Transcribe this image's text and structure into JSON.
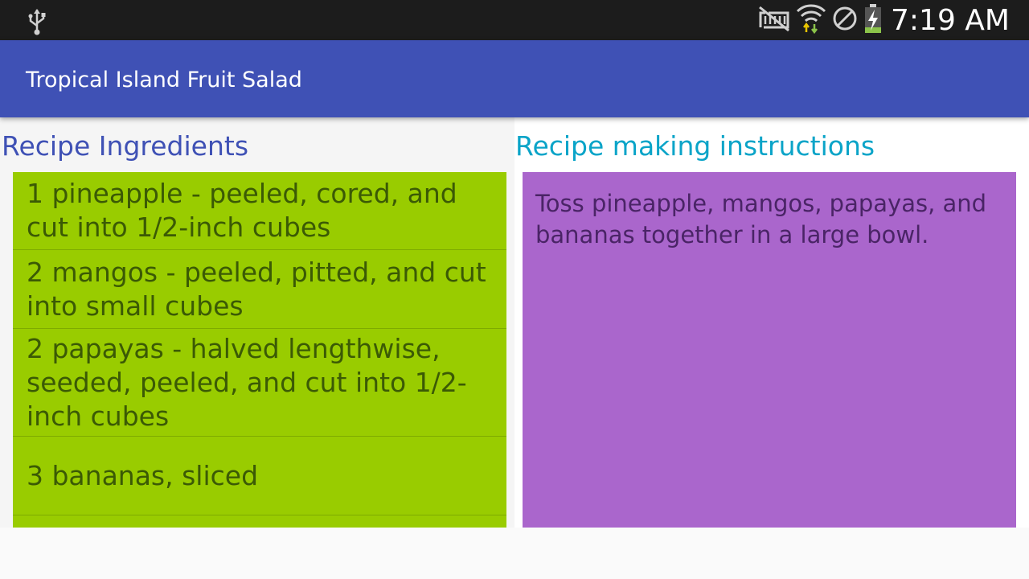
{
  "status_bar": {
    "time": "7:19 AM",
    "icons": [
      "usb-icon",
      "no-sim-icon",
      "wifi-icon",
      "do-not-disturb-icon",
      "battery-charging-icon"
    ]
  },
  "app_bar": {
    "title": "Tropical Island Fruit Salad",
    "color": "#3f51b5"
  },
  "ingredients": {
    "heading": "Recipe Ingredients",
    "background": "#99cc00",
    "items": [
      "1 pineapple - peeled, cored, and cut into 1/2-inch cubes",
      "2 mangos - peeled, pitted, and cut into small cubes",
      "2 papayas - halved lengthwise, seeded, peeled, and cut into 1/2-inch cubes",
      "3 bananas, sliced"
    ]
  },
  "instructions": {
    "heading": "Recipe making instructions",
    "background": "#aa66cc",
    "text": "Toss pineapple, mangos, papayas, and bananas together in a large bowl."
  }
}
